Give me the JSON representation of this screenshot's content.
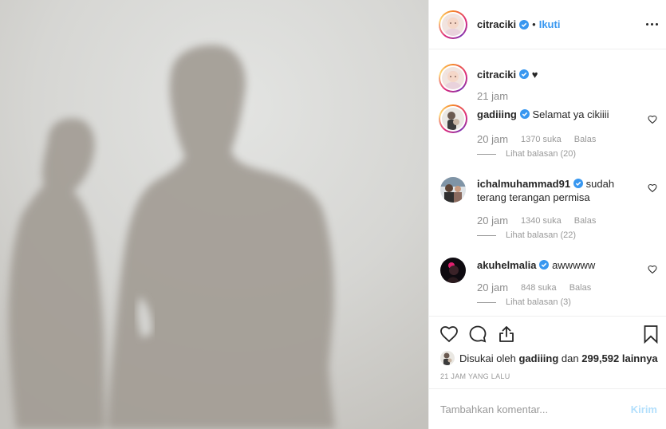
{
  "photo": {
    "alt": ""
  },
  "header": {
    "username": "citraciki",
    "separator": "•",
    "follow_label": "Ikuti"
  },
  "caption": {
    "username": "citraciki",
    "text": "♥",
    "time": "21 jam"
  },
  "comments": [
    {
      "username": "gadiiing",
      "text": "Selamat ya cikiiii",
      "time": "20 jam",
      "likes": "1370 suka",
      "reply_label": "Balas",
      "view_replies": "Lihat balasan (20)"
    },
    {
      "username": "ichalmuhammad91",
      "text": "sudah terang terangan permisa",
      "time": "20 jam",
      "likes": "1340 suka",
      "reply_label": "Balas",
      "view_replies": "Lihat balasan (22)"
    },
    {
      "username": "akuhelmalia",
      "text": "awwwww",
      "time": "20 jam",
      "likes": "848 suka",
      "reply_label": "Balas",
      "view_replies": "Lihat balasan (3)"
    }
  ],
  "likes_line": {
    "prefix": "Disukai oleh",
    "user": "gadiiing",
    "conj": "dan",
    "others": "299,592 lainnya"
  },
  "post_time": "21 JAM YANG LALU",
  "add_comment": {
    "placeholder": "Tambahkan komentar...",
    "post_label": "Kirim"
  },
  "colors": {
    "accent": "#3897f0",
    "verified": "#3897f0",
    "post_disabled": "#b2dffc"
  }
}
